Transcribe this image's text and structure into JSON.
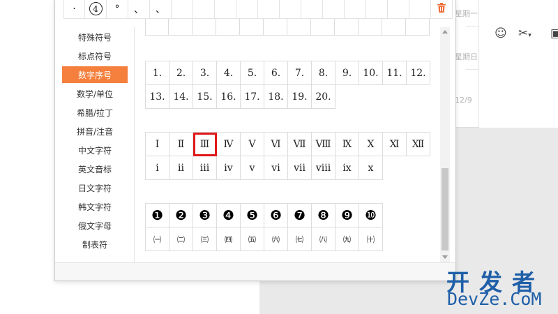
{
  "background": {
    "day_labels": [
      "星期一",
      "星期日",
      "12/9"
    ],
    "toolbar_icons": [
      "smiley-icon",
      "scissors-icon",
      "image-icon"
    ]
  },
  "recent": {
    "symbols": [
      "·",
      "④",
      "°",
      "、",
      "、",
      "",
      "",
      "",
      "",
      "",
      "",
      "",
      "",
      "",
      "",
      "",
      "",
      ""
    ]
  },
  "sidebar": {
    "categories": [
      "特殊符号",
      "标点符号",
      "数字序号",
      "数学/单位",
      "希腊/拉丁",
      "拼音/注音",
      "中文字符",
      "英文音标",
      "日文字符",
      "韩文字符",
      "俄文字母",
      "制表符"
    ],
    "active_index": 2
  },
  "groups": {
    "numbered_period": [
      "1.",
      "2.",
      "3.",
      "4.",
      "5.",
      "6.",
      "7.",
      "8.",
      "9.",
      "10.",
      "11.",
      "12.",
      "13.",
      "14.",
      "15.",
      "16.",
      "17.",
      "18.",
      "19.",
      "20."
    ],
    "roman_upper": [
      "Ⅰ",
      "Ⅱ",
      "Ⅲ",
      "Ⅳ",
      "Ⅴ",
      "Ⅵ",
      "Ⅶ",
      "Ⅷ",
      "Ⅸ",
      "Ⅹ",
      "Ⅺ",
      "Ⅻ"
    ],
    "roman_lower": [
      "i",
      "ii",
      "iii",
      "iv",
      "v",
      "vi",
      "vii",
      "viii",
      "ix",
      "x"
    ],
    "circled_negative": [
      "❶",
      "❷",
      "❸",
      "❹",
      "❺",
      "❻",
      "❼",
      "❽",
      "❾",
      "❿"
    ],
    "parenthesized_cjk": [
      "㈠",
      "㈡",
      "㈢",
      "㈣",
      "㈤",
      "㈥",
      "㈦",
      "㈧",
      "㈨",
      "㈩"
    ],
    "selected_symbol": "Ⅲ"
  },
  "watermark": {
    "line1": "开发者",
    "line2": "DevZe.CoM"
  },
  "colors": {
    "accent": "#f57f3c",
    "selection": "#e01818",
    "watermark": "#1f5fa8"
  }
}
